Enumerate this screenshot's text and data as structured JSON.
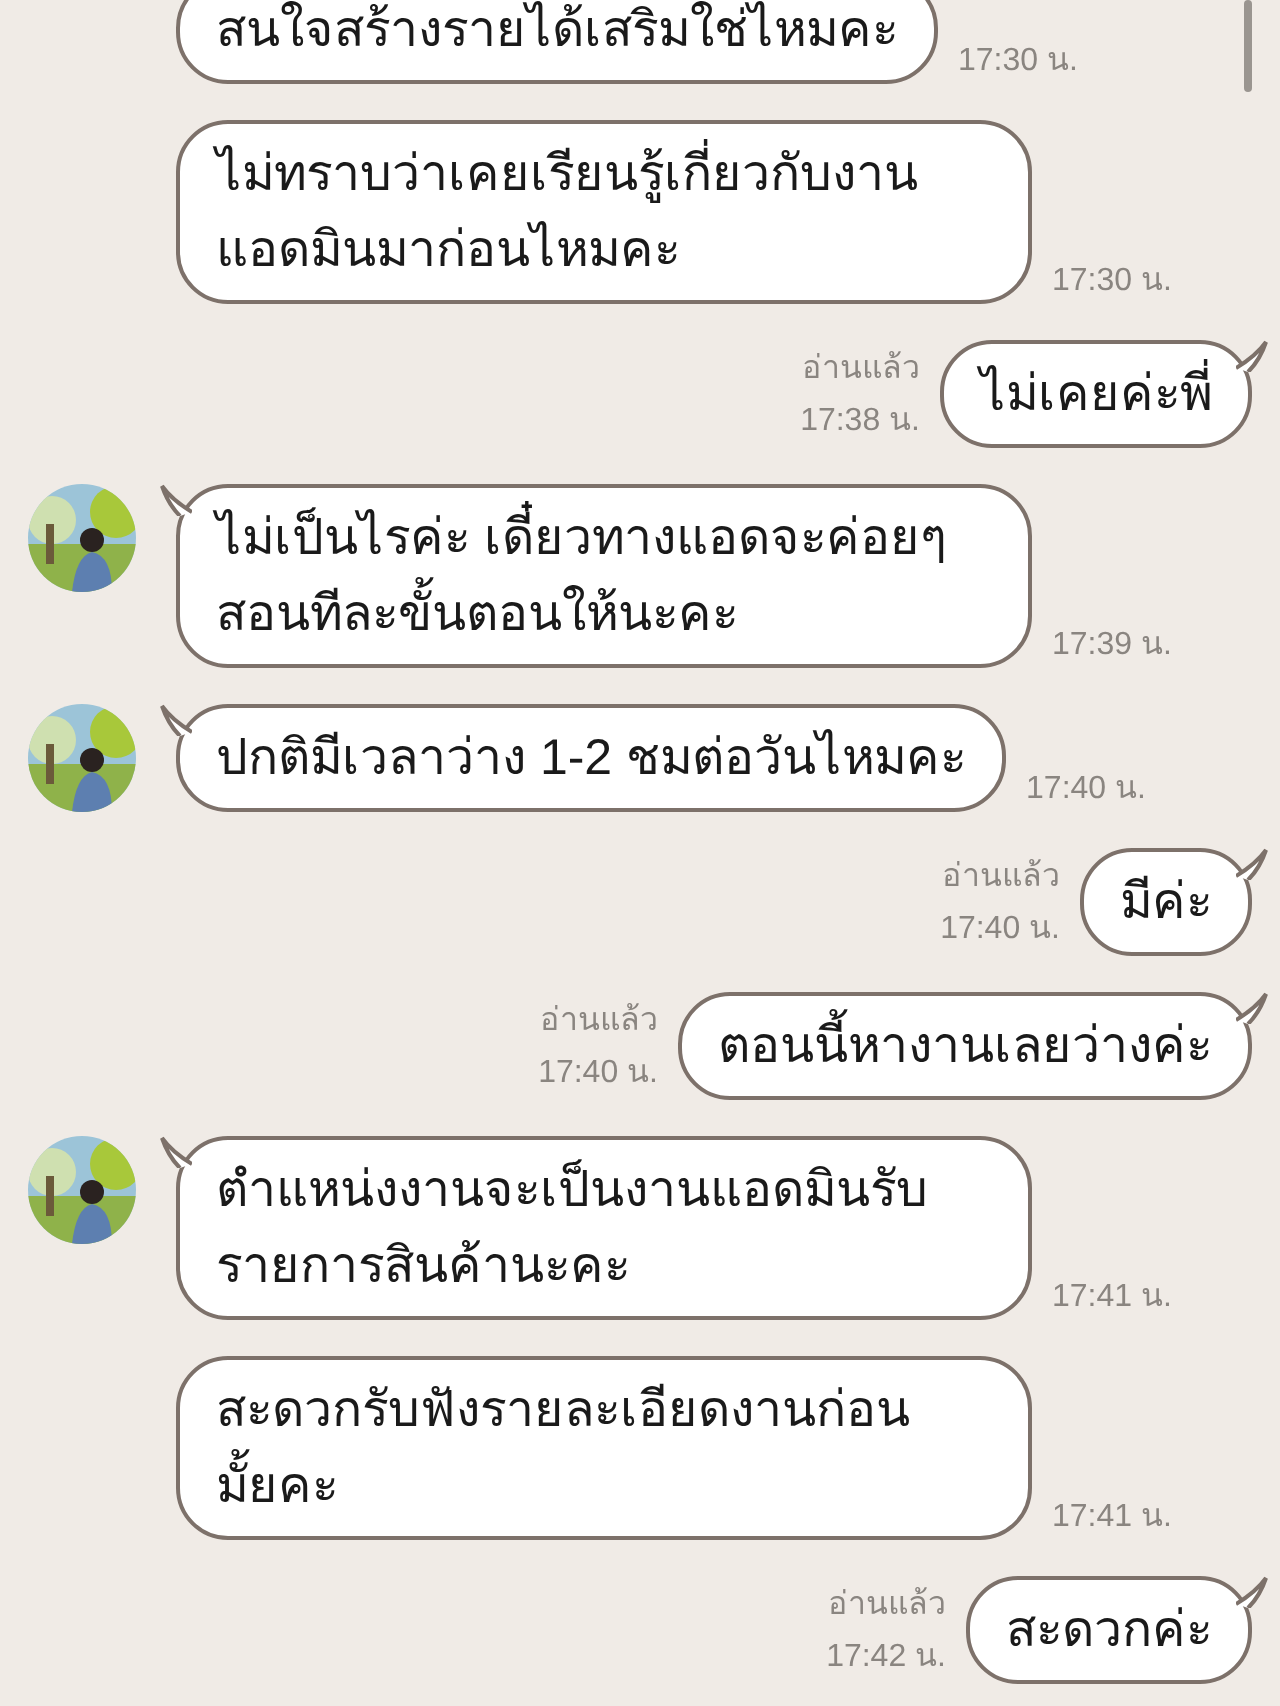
{
  "messages": [
    {
      "kind": "incoming",
      "avatar": false,
      "lines": [
        "สนใจสร้างรายได้เสริมใช่ไหมคะ"
      ],
      "time": "17:30 น.",
      "clipped": true
    },
    {
      "kind": "incoming",
      "avatar": false,
      "lines": [
        "ไม่ทราบว่าเคยเรียนรู้เกี่ยวกับงาน",
        "แอดมินมาก่อนไหมคะ"
      ],
      "time": "17:30 น."
    },
    {
      "kind": "outgoing",
      "lines": [
        "ไม่เคยค่ะพี่"
      ],
      "read": "อ่านแล้ว",
      "time": "17:38 น."
    },
    {
      "kind": "incoming",
      "avatar": true,
      "lines": [
        "ไม่เป็นไรค่ะ เดี๋ยวทางแอดจะค่อยๆ",
        "สอนทีละขั้นตอนให้นะคะ"
      ],
      "time": "17:39 น."
    },
    {
      "kind": "incoming",
      "avatar": true,
      "lines": [
        "ปกติมีเวลาว่าง 1-2 ชมต่อวันไหมคะ"
      ],
      "time": "17:40 น."
    },
    {
      "kind": "outgoing",
      "lines": [
        "มีค่ะ"
      ],
      "read": "อ่านแล้ว",
      "time": "17:40 น."
    },
    {
      "kind": "outgoing",
      "lines": [
        "ตอนนี้หางานเลยว่างค่ะ"
      ],
      "read": "อ่านแล้ว",
      "time": "17:40 น."
    },
    {
      "kind": "incoming",
      "avatar": true,
      "lines": [
        "ตำแหน่งงานจะเป็นงานแอดมินรับ",
        "รายการสินค้านะคะ"
      ],
      "time": "17:41 น."
    },
    {
      "kind": "incoming",
      "avatar": false,
      "lines": [
        "สะดวกรับฟังรายละเอียดงานก่อน",
        "มั้ยคะ"
      ],
      "time": "17:41 น."
    },
    {
      "kind": "outgoing",
      "lines": [
        "สะดวกค่ะ"
      ],
      "read": "อ่านแล้ว",
      "time": "17:42 น."
    }
  ]
}
